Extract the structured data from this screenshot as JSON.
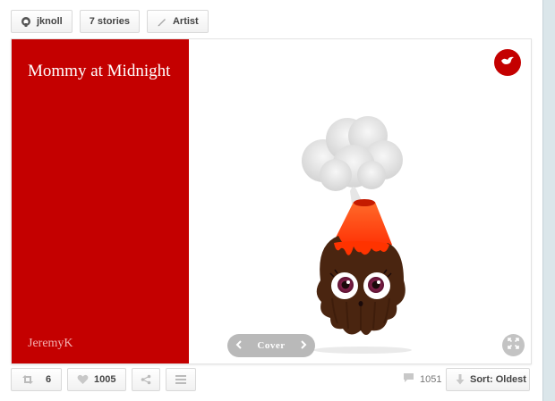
{
  "topbar": {
    "user_label": "jknoll",
    "stories_label": "7 stories",
    "artist_label": "Artist"
  },
  "story": {
    "title": "Mommy at Midnight",
    "author": "JeremyK"
  },
  "viewer": {
    "page_label": "Cover"
  },
  "bottombar": {
    "repost_count": "6",
    "like_count": "1005",
    "comment_count": "1051",
    "sort_label": "Sort: Oldest"
  },
  "icons": {
    "user": "github-octocat-icon",
    "artist": "pencil-icon",
    "badge": "bird-icon",
    "prev": "chevron-left-icon",
    "next": "chevron-right-icon",
    "expand": "expand-arrows-icon",
    "repost": "repost-icon",
    "like": "heart-icon",
    "share": "share-icon",
    "menu": "menu-lines-icon",
    "comment": "comment-icon",
    "sort": "down-arrow-icon"
  },
  "colors": {
    "cover_red": "#c40000",
    "lava": "#ff3300",
    "creature_brown": "#4a2510"
  }
}
